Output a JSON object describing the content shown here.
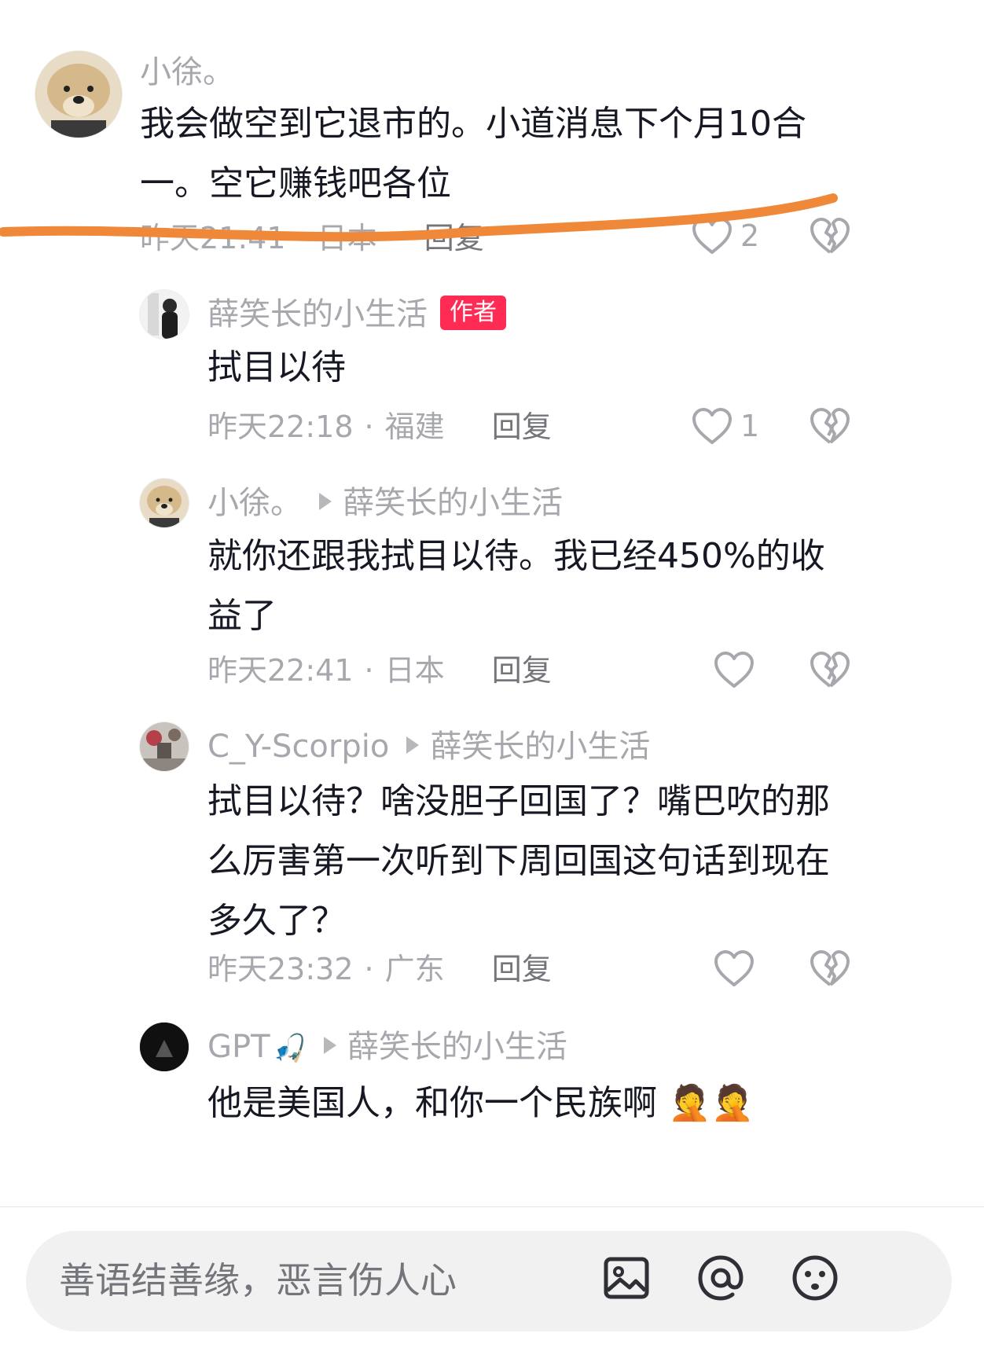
{
  "comments": [
    {
      "name": "小徐。",
      "text_lines": [
        "我会做空到它退市的。小道消息下个月10合",
        "一。空它赚钱吧各位"
      ],
      "time": "昨天21:41",
      "location": "日本",
      "reply_label": "回复",
      "likes": "2"
    },
    {
      "name": "薛笑长的小生活",
      "badge": "作者",
      "text_lines": [
        "拭目以待"
      ],
      "time": "昨天22:18",
      "location": "福建",
      "reply_label": "回复",
      "likes": "1"
    },
    {
      "name": "小徐。",
      "reply_to": "薛笑长的小生活",
      "text_lines": [
        "就你还跟我拭目以待。我已经450%的收",
        "益了"
      ],
      "time": "昨天22:41",
      "location": "日本",
      "reply_label": "回复",
      "likes": ""
    },
    {
      "name": "C_Y-Scorpio",
      "reply_to": "薛笑长的小生活",
      "text_lines": [
        "拭目以待？啥没胆子回国了？嘴巴吹的那",
        "么厉害第一次听到下周回国这句话到现在",
        "多久了？"
      ],
      "time": "昨天23:32",
      "location": "广东",
      "reply_label": "回复",
      "likes": ""
    },
    {
      "name": "GPT",
      "reply_to": "薛笑长的小生活",
      "text_lines": [
        "他是美国人，和你一个民族啊"
      ],
      "time": "",
      "location": "",
      "reply_label": "",
      "likes": ""
    }
  ],
  "input": {
    "placeholder": "善语结善缘，恶言伤人心"
  },
  "icons": {
    "like": "heart-outline-icon",
    "dislike": "broken-heart-icon",
    "image": "image-icon",
    "mention": "at-icon",
    "emoji": "emoji-icon"
  },
  "colors": {
    "author_badge": "#fe2c55",
    "annotation_stroke": "#f0883a",
    "muted_text": "#a7a8ad"
  }
}
